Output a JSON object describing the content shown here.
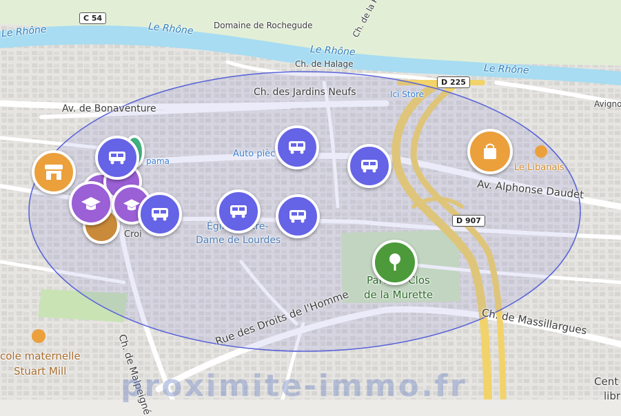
{
  "rivers": [
    "Le Rhône",
    "Le Rhône",
    "Le Rhône",
    "Le Rhône"
  ],
  "road_shields": [
    "C 54",
    "D 225",
    "D 907"
  ],
  "streets": {
    "ch_de_la_p": "Ch. de la P",
    "domaine": "Domaine de Rochegude",
    "halage": "Ch. de Halage",
    "jardins": "Ch. des Jardins Neufs",
    "bonaventure": "Av. de Bonaventure",
    "alphonse": "Av. Alphonse Daudet",
    "massillargues": "Ch. de Massillargues",
    "droits": "Rue des Droits de l'Homme",
    "malpeigne": "Ch. de Malpeigné",
    "avigno": "Avigno"
  },
  "pois": {
    "ici_store": "Ici Store",
    "auto_piece": "Auto pièc",
    "pama": "pama",
    "le_libanais": "Le Libanais",
    "eglise_line1": "Église Notre-",
    "eglise_line2": "Dame de Lourdes",
    "croix": "Croi",
    "parc_line1": "Parc du Clos",
    "parc_line2": "de la Murette",
    "ecole_line1": "cole maternelle",
    "ecole_line2": "Stuart Mill",
    "centre_line1": "Cent",
    "centre_line2": "libr"
  },
  "markers": [
    {
      "kind": "bus",
      "icon": "bus-icon"
    },
    {
      "kind": "bus",
      "icon": "bus-icon"
    },
    {
      "kind": "bus",
      "icon": "bus-icon"
    },
    {
      "kind": "bus",
      "icon": "bus-icon"
    },
    {
      "kind": "bus",
      "icon": "bus-icon"
    },
    {
      "kind": "bus",
      "icon": "bus-icon"
    },
    {
      "kind": "school",
      "icon": "graduation-cap-icon"
    },
    {
      "kind": "shop",
      "icon": "shopping-bag-icon"
    },
    {
      "kind": "shop",
      "icon": "store-icon"
    },
    {
      "kind": "park",
      "icon": "tree-icon"
    }
  ],
  "watermark": "proximite-immo.fr",
  "colors": {
    "water": "#a7dcf2",
    "bus": "#6563e6",
    "school": "#9b5fd6",
    "shop": "#eba03c",
    "park": "#4c9a3a",
    "radius": "#5a64d8",
    "highway": "#f2d36b"
  }
}
